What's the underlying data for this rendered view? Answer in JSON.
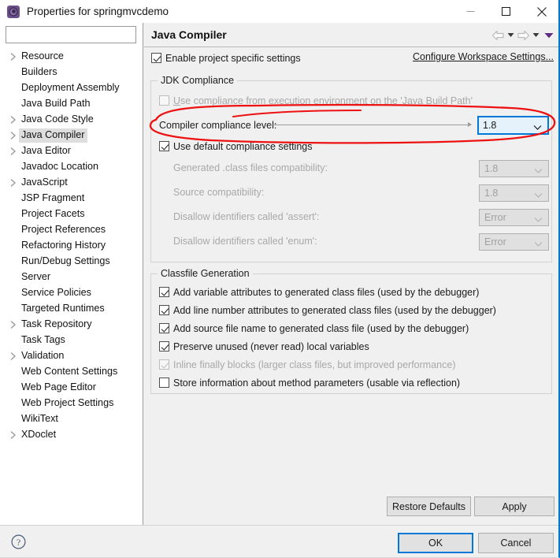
{
  "window": {
    "title": "Properties for springmvcdemo",
    "icon": "properties-gear-icon",
    "minimize_label": "Minimize",
    "maximize_label": "Maximize",
    "close_label": "Close"
  },
  "sidebar": {
    "filter_value": "",
    "filter_placeholder": "",
    "items": [
      {
        "label": "Resource",
        "expandable": true,
        "selected": false
      },
      {
        "label": "Builders",
        "expandable": false,
        "selected": false
      },
      {
        "label": "Deployment Assembly",
        "expandable": false,
        "selected": false
      },
      {
        "label": "Java Build Path",
        "expandable": false,
        "selected": false
      },
      {
        "label": "Java Code Style",
        "expandable": true,
        "selected": false
      },
      {
        "label": "Java Compiler",
        "expandable": true,
        "selected": true
      },
      {
        "label": "Java Editor",
        "expandable": true,
        "selected": false
      },
      {
        "label": "Javadoc Location",
        "expandable": false,
        "selected": false
      },
      {
        "label": "JavaScript",
        "expandable": true,
        "selected": false
      },
      {
        "label": "JSP Fragment",
        "expandable": false,
        "selected": false
      },
      {
        "label": "Project Facets",
        "expandable": false,
        "selected": false
      },
      {
        "label": "Project References",
        "expandable": false,
        "selected": false
      },
      {
        "label": "Refactoring History",
        "expandable": false,
        "selected": false
      },
      {
        "label": "Run/Debug Settings",
        "expandable": false,
        "selected": false
      },
      {
        "label": "Server",
        "expandable": false,
        "selected": false
      },
      {
        "label": "Service Policies",
        "expandable": false,
        "selected": false
      },
      {
        "label": "Targeted Runtimes",
        "expandable": false,
        "selected": false
      },
      {
        "label": "Task Repository",
        "expandable": true,
        "selected": false
      },
      {
        "label": "Task Tags",
        "expandable": false,
        "selected": false
      },
      {
        "label": "Validation",
        "expandable": true,
        "selected": false
      },
      {
        "label": "Web Content Settings",
        "expandable": false,
        "selected": false
      },
      {
        "label": "Web Page Editor",
        "expandable": false,
        "selected": false
      },
      {
        "label": "Web Project Settings",
        "expandable": false,
        "selected": false
      },
      {
        "label": "WikiText",
        "expandable": false,
        "selected": false
      },
      {
        "label": "XDoclet",
        "expandable": true,
        "selected": false
      }
    ]
  },
  "content": {
    "page_title": "Java Compiler",
    "nav": {
      "back_icon": "arrow-left-icon",
      "back_menu_icon": "chevron-down-icon",
      "forward_icon": "arrow-right-icon",
      "forward_menu_icon": "chevron-down-icon",
      "menu_icon": "chevron-down-filled-icon"
    },
    "enable_project_specific": {
      "label": "Enable project specific settings",
      "checked": true
    },
    "configure_workspace_link": "Configure Workspace Settings...",
    "jdk_compliance": {
      "title": "JDK Compliance",
      "use_execution_env": {
        "label": "Use compliance from execution environment on the 'Java Build Path'",
        "checked": false,
        "enabled": false
      },
      "compiler_compliance_level": {
        "label": "Compiler compliance level:",
        "value": "1.8",
        "enabled": true,
        "focused": true
      },
      "use_default_compliance": {
        "label": "Use default compliance settings",
        "checked": true,
        "enabled": true
      },
      "rows": [
        {
          "label": "Generated .class files compatibility:",
          "value": "1.8",
          "enabled": false
        },
        {
          "label": "Source compatibility:",
          "value": "1.8",
          "enabled": false
        },
        {
          "label": "Disallow identifiers called 'assert':",
          "value": "Error",
          "enabled": false
        },
        {
          "label": "Disallow identifiers called 'enum':",
          "value": "Error",
          "enabled": false
        }
      ]
    },
    "classfile_generation": {
      "title": "Classfile Generation",
      "options": [
        {
          "label": "Add variable attributes to generated class files (used by the debugger)",
          "checked": true,
          "enabled": true
        },
        {
          "label": "Add line number attributes to generated class files (used by the debugger)",
          "checked": true,
          "enabled": true
        },
        {
          "label": "Add source file name to generated class file (used by the debugger)",
          "checked": true,
          "enabled": true
        },
        {
          "label": "Preserve unused (never read) local variables",
          "checked": true,
          "enabled": true
        },
        {
          "label": "Inline finally blocks (larger class files, but improved performance)",
          "checked": true,
          "enabled": false
        },
        {
          "label": "Store information about method parameters (usable via reflection)",
          "checked": false,
          "enabled": true
        }
      ]
    },
    "restore_defaults_label": "Restore Defaults",
    "apply_label": "Apply"
  },
  "footer": {
    "help_icon": "help-question-icon",
    "ok_label": "OK",
    "cancel_label": "Cancel"
  },
  "annotation": {
    "type": "hand-drawn-ellipse",
    "color": "#ee1111",
    "target": "Compiler compliance level row"
  },
  "colors": {
    "accent": "#0078d7",
    "annotation": "#ee1111",
    "dialog_bg": "#f0f0f0",
    "panel_bg": "#ffffff",
    "selected_row": "#dedede"
  }
}
